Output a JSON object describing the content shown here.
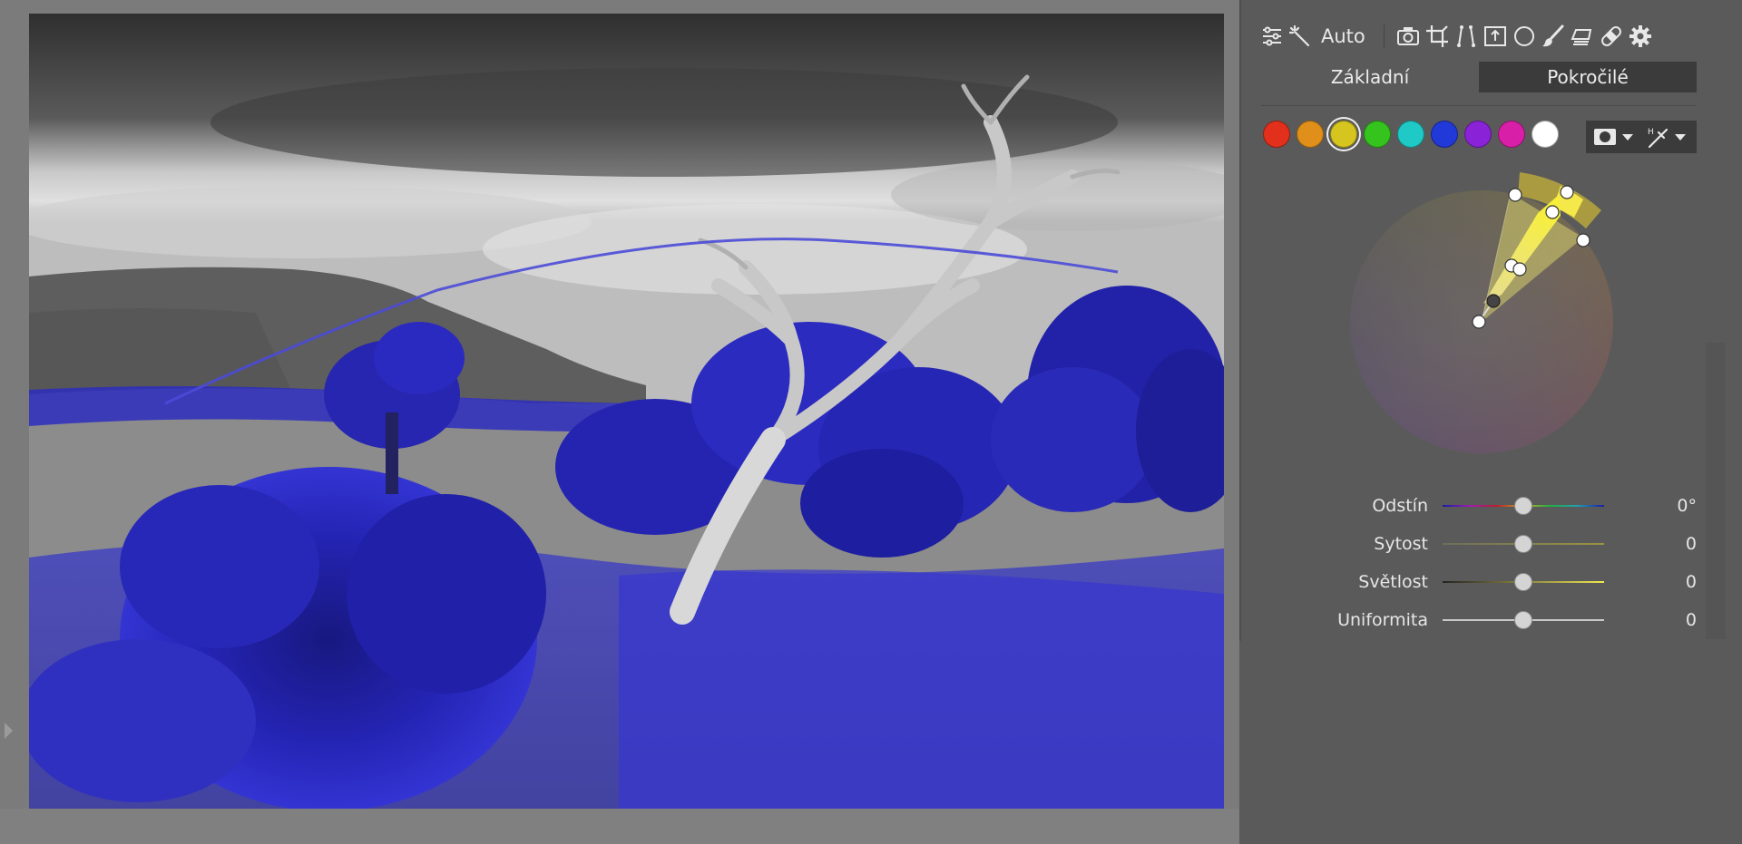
{
  "toolbar": {
    "auto_label": "Auto",
    "icons": [
      "sliders-icon",
      "magic-wand-icon",
      "camera-icon",
      "crop-icon",
      "perspective-icon",
      "upload-icon",
      "circle-icon",
      "brush-icon",
      "eraser-icon",
      "bandage-icon",
      "gear-icon"
    ]
  },
  "tabs": [
    {
      "label": "Základní",
      "active": false
    },
    {
      "label": "Pokročilé",
      "active": true
    }
  ],
  "swatches": [
    {
      "name": "red",
      "color": "#e2301c"
    },
    {
      "name": "orange",
      "color": "#e0901a"
    },
    {
      "name": "yellow",
      "color": "#d6c51e",
      "selected": true
    },
    {
      "name": "green",
      "color": "#35c41e"
    },
    {
      "name": "cyan",
      "color": "#1fc9c6"
    },
    {
      "name": "blue",
      "color": "#2139d8"
    },
    {
      "name": "purple",
      "color": "#8a22d8"
    },
    {
      "name": "magenta",
      "color": "#d71fa7"
    },
    {
      "name": "white",
      "color": "#ffffff"
    }
  ],
  "mask_tools": [
    "mask-icon",
    "picker-icon"
  ],
  "sliders": [
    {
      "label": "Odstín",
      "value": "0°",
      "level": 0.5
    },
    {
      "label": "Sytost",
      "value": "0",
      "level": 0.5
    },
    {
      "label": "Světlost",
      "value": "0",
      "level": 0.5
    },
    {
      "label": "Uniformita",
      "value": "0",
      "level": 0.5
    }
  ],
  "colors": {
    "accent_highlight": "#2a2ae0",
    "panel_bg": "#5a5a5a",
    "active_tab_bg": "#3b3b3b"
  }
}
